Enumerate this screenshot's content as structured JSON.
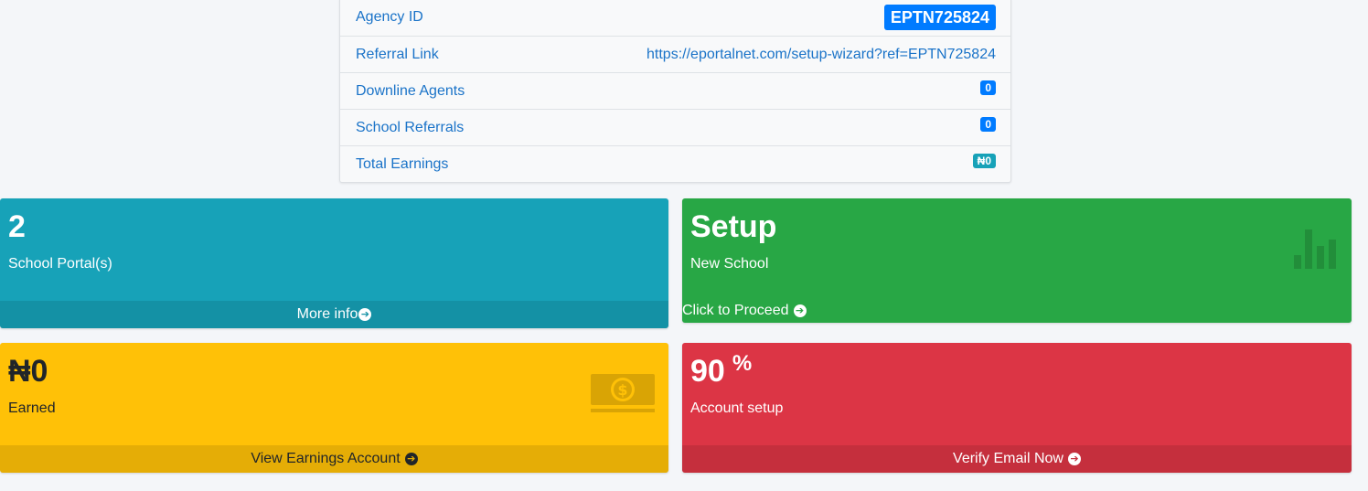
{
  "profile": {
    "rows": [
      {
        "label": "Agency ID",
        "value": "EPTN725824"
      },
      {
        "label": "Referral Link",
        "value": "https://eportalnet.com/setup-wizard?ref=EPTN725824"
      },
      {
        "label": "Downline Agents",
        "value": "0"
      },
      {
        "label": "School Referrals",
        "value": "0"
      },
      {
        "label": "Total Earnings",
        "value": "₦0"
      }
    ]
  },
  "boxes": {
    "portals": {
      "value": "2",
      "label": "School Portal(s)",
      "footer": "More info",
      "color": "#17a2b8"
    },
    "setup": {
      "value": "Setup",
      "label": "New School",
      "footer": "Click to Proceed",
      "color": "#28a745",
      "icon": "bar-chart-icon"
    },
    "earned": {
      "value": "₦0",
      "label": "Earned",
      "footer": "View Earnings Account",
      "color": "#ffc107",
      "icon": "money-bill-icon"
    },
    "account": {
      "value": "90",
      "unit": "%",
      "label": "Account setup",
      "footer": "Verify Email Now",
      "color": "#dc3545"
    }
  }
}
